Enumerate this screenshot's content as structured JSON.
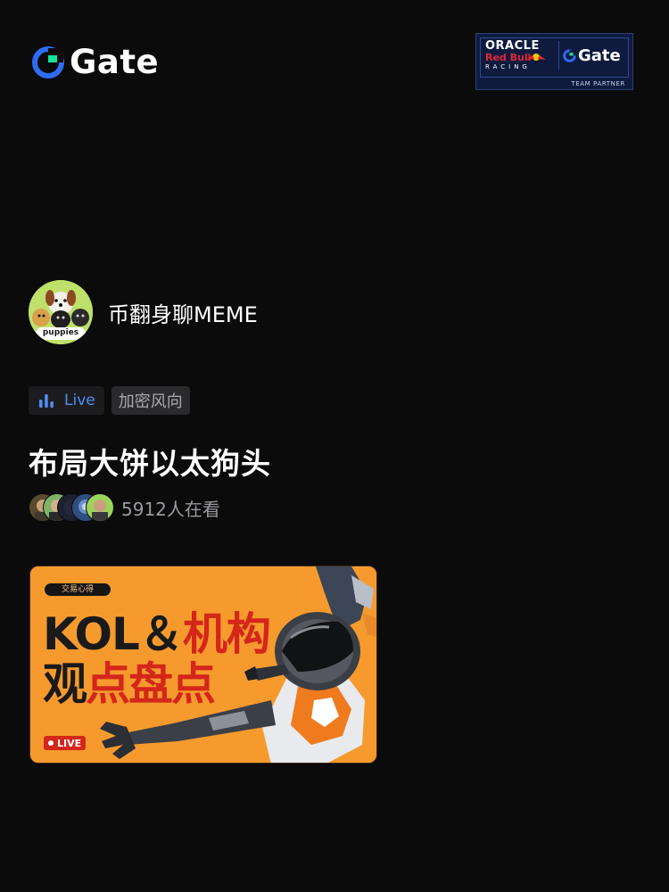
{
  "header": {
    "brand_name": "Gate",
    "brand_icon": "gate-logo-icon",
    "partner": {
      "oracle": "ORACLE",
      "redbull": "Red Bull",
      "racing": "RACING",
      "gate": "Gate",
      "team": "TEAM PARTNER"
    }
  },
  "channel": {
    "name": "币翻身聊MEME",
    "avatar_text": "puppies"
  },
  "tags": {
    "live_label": "Live",
    "category": "加密风向"
  },
  "stream": {
    "title": "布局大饼以太狗头",
    "viewers": "5912人在看"
  },
  "banner": {
    "pill": "交易心得",
    "line1_dark": "KOL＆",
    "line1_accent": "机构",
    "line2_dark": "观",
    "line2_accent": "点盘点",
    "live_badge": "LIVE"
  },
  "colors": {
    "background": "#0b0b0b",
    "live_blue": "#4f8df7",
    "banner_orange": "#f79a2e",
    "accent_red": "#d4261a"
  }
}
